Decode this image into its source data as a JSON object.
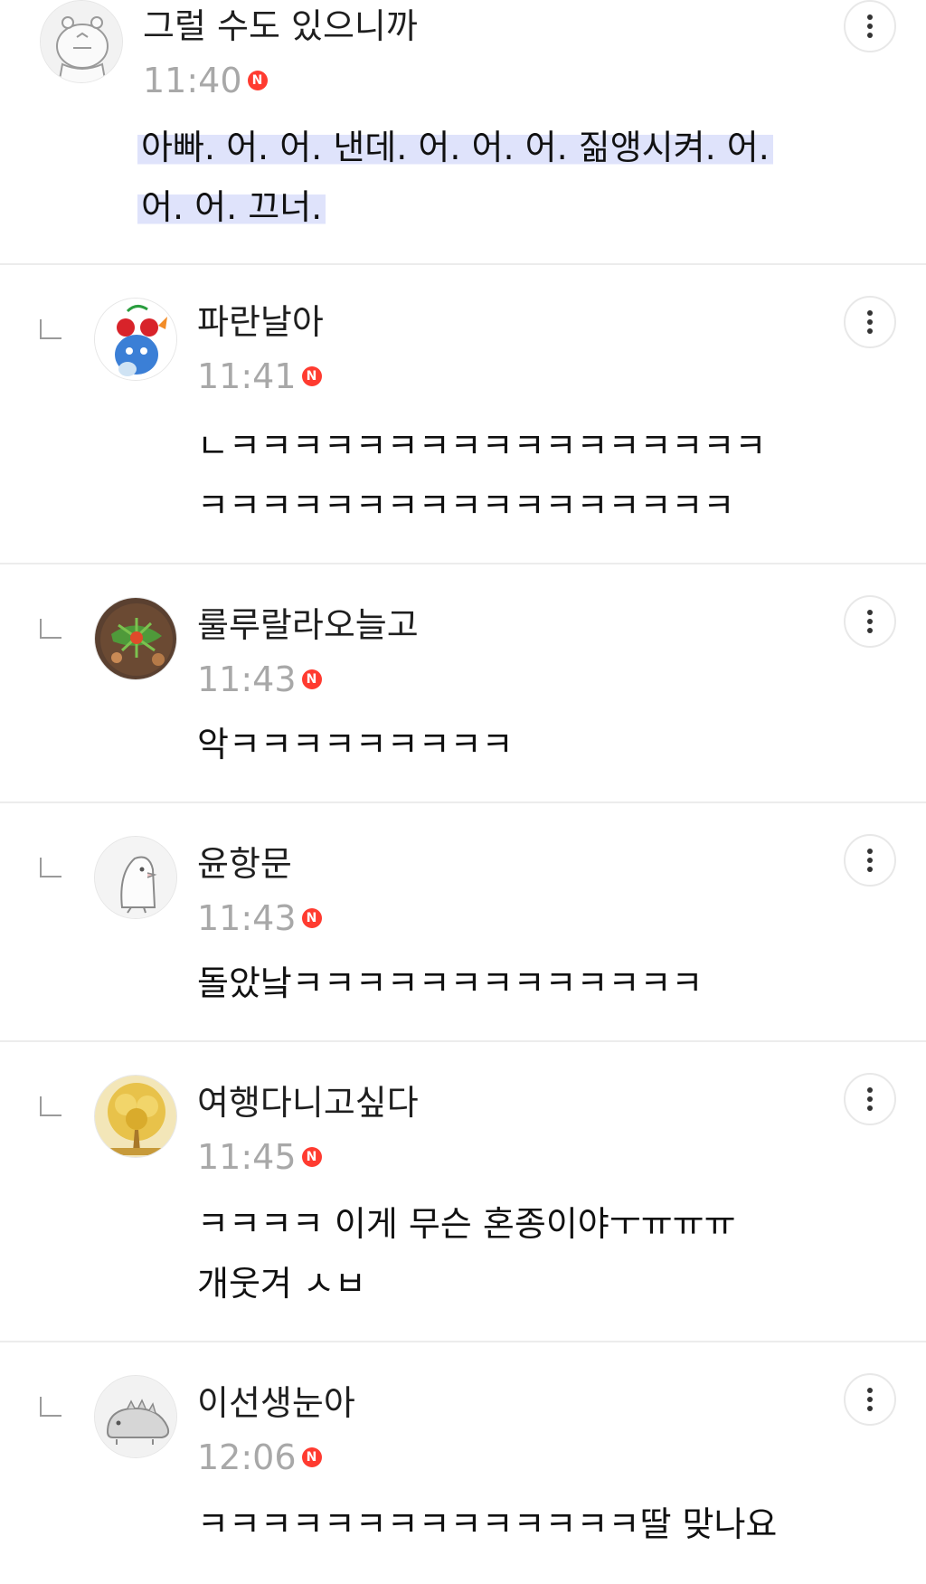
{
  "comments": [
    {
      "author": "그럴 수도 있으니까",
      "time": "11:40",
      "badge": "N",
      "avatar_icon": "hippo-avatar-icon",
      "highlighted": true,
      "lines": [
        "아빠. 어. 어. 낸데. 어. 어. 어. 짊앵시켜. 어.",
        "어. 어. 끄너."
      ]
    },
    {
      "author": "파란날아",
      "time": "11:41",
      "badge": "N",
      "avatar_icon": "blue-character-avatar-icon",
      "lines": [
        "ㄴㅋㅋㅋㅋㅋㅋㅋㅋㅋㅋㅋㅋㅋㅋㅋㅋㅋ",
        "ㅋㅋㅋㅋㅋㅋㅋㅋㅋㅋㅋㅋㅋㅋㅋㅋㅋ"
      ]
    },
    {
      "author": "룰루랄라오늘고",
      "time": "11:43",
      "badge": "N",
      "avatar_icon": "food-photo-avatar-icon",
      "lines": [
        "악ㅋㅋㅋㅋㅋㅋㅋㅋㅋ"
      ]
    },
    {
      "author": "윤항문",
      "time": "11:43",
      "badge": "N",
      "avatar_icon": "bird-avatar-icon",
      "lines": [
        "돌았낰ㅋㅋㅋㅋㅋㅋㅋㅋㅋㅋㅋㅋㅋ"
      ]
    },
    {
      "author": "여행다니고싶다",
      "time": "11:45",
      "badge": "N",
      "avatar_icon": "golden-tree-avatar-icon",
      "lines": [
        "ㅋㅋㅋㅋ 이게 무슨 혼종이야ㅜㅠㅠㅠ",
        "개웃겨 ㅅㅂ"
      ]
    },
    {
      "author": "이선생눈아",
      "time": "12:06",
      "badge": "N",
      "avatar_icon": "dinosaur-avatar-icon",
      "lines": [
        "ㅋㅋㅋㅋㅋㅋㅋㅋㅋㅋㅋㅋㅋㅋ딸 맞나요"
      ]
    }
  ],
  "colors": {
    "timestamp": "#a8a8a8",
    "new_badge": "#ff3b30",
    "highlight": "#dfe3fb",
    "divider": "#ececec"
  }
}
